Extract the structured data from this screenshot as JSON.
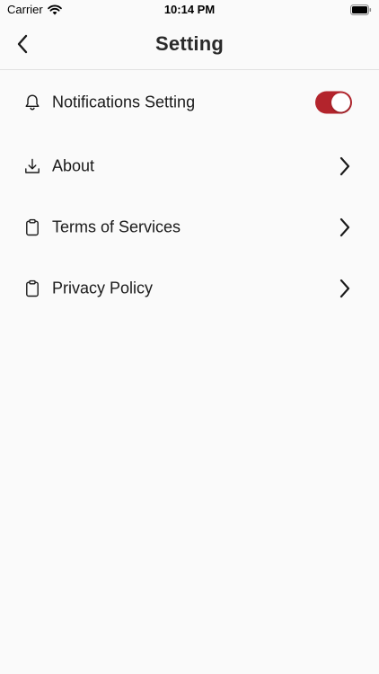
{
  "status_bar": {
    "carrier": "Carrier",
    "time": "10:14 PM",
    "wifi_icon": "wifi-icon",
    "battery_icon": "battery-icon"
  },
  "nav": {
    "title": "Setting",
    "back_icon": "chevron-left-icon"
  },
  "settings": {
    "items": [
      {
        "label": "Notifications Setting",
        "icon": "bell-icon",
        "control": "toggle",
        "toggle_on": true
      },
      {
        "label": "About",
        "icon": "download-icon",
        "control": "chevron"
      },
      {
        "label": "Terms of Services",
        "icon": "clipboard-icon",
        "control": "chevron"
      },
      {
        "label": "Privacy Policy",
        "icon": "clipboard-icon",
        "control": "chevron"
      }
    ]
  },
  "colors": {
    "accent": "#b3242c",
    "background": "#fafafa",
    "text": "#1a1a1a"
  }
}
